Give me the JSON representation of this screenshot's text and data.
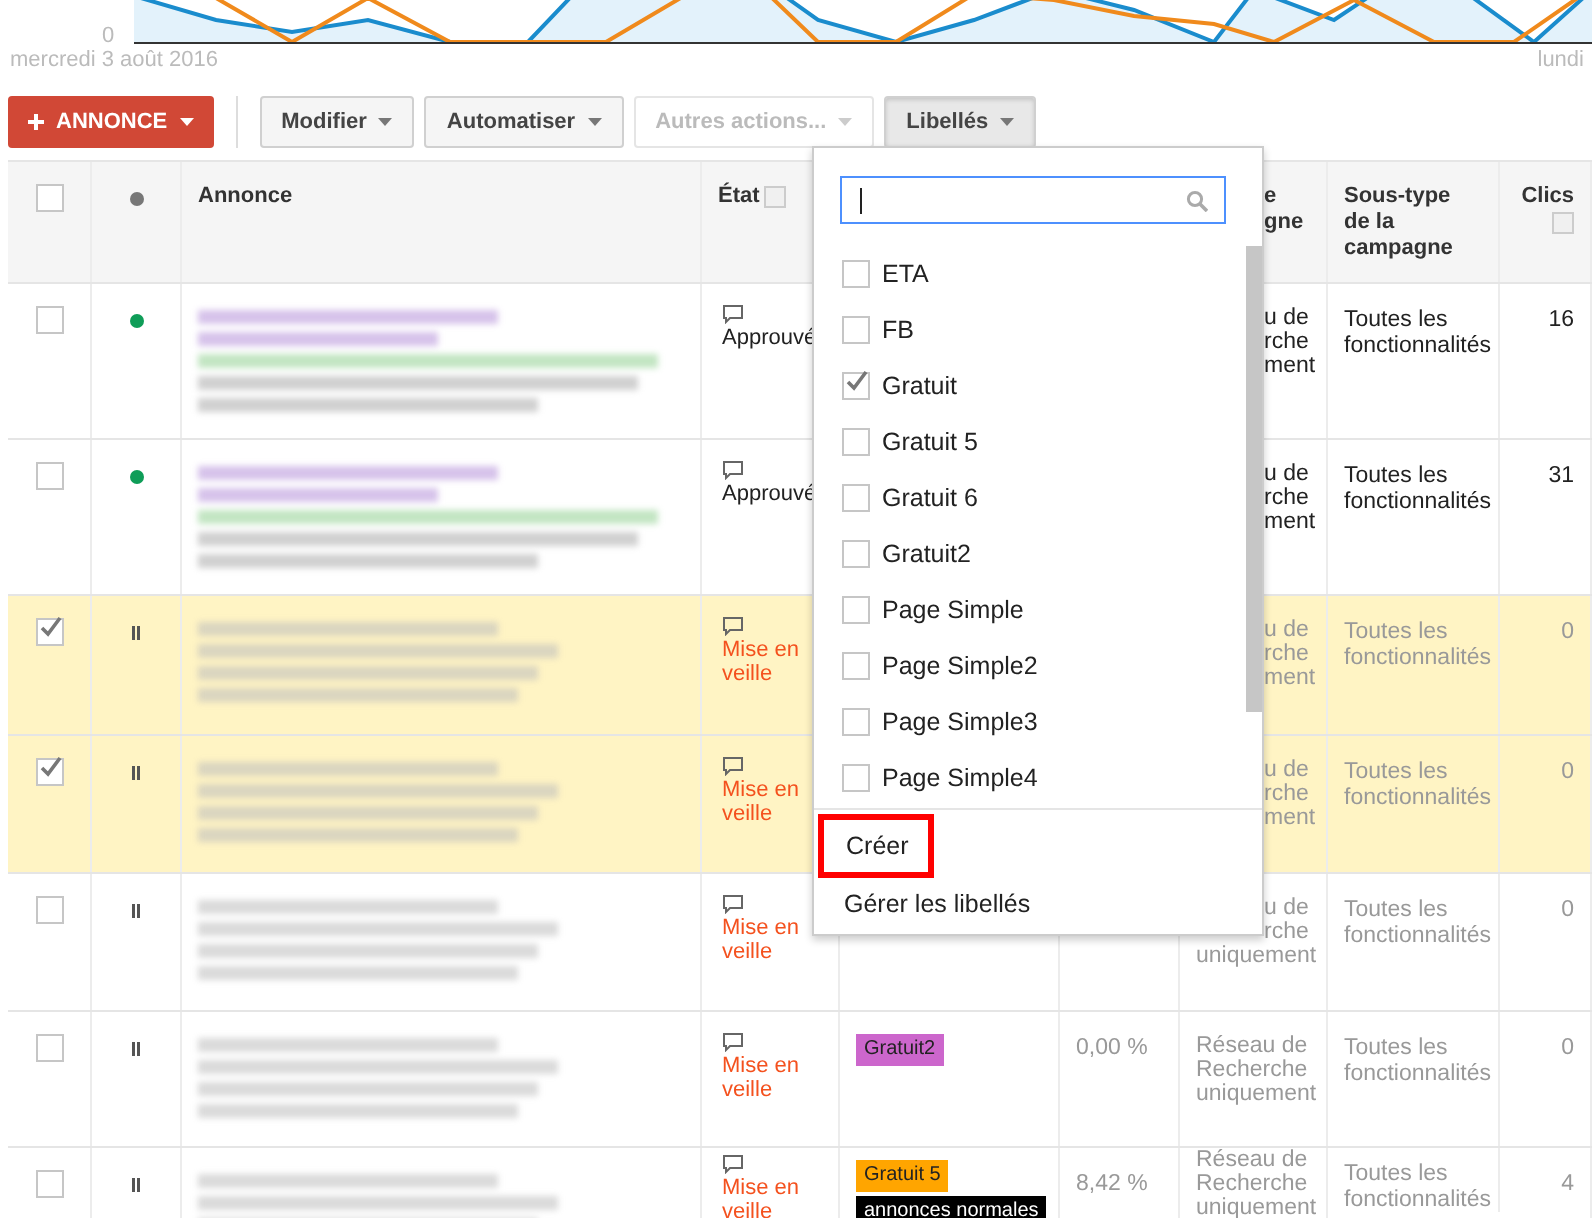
{
  "chart": {
    "y_tick": "0",
    "start_date": "mercredi 3 août 2016",
    "end_date": "lundi"
  },
  "toolbar": {
    "new_button": "ANNONCE",
    "buttons": [
      {
        "label": "Modifier",
        "disabled": false,
        "pressed": false
      },
      {
        "label": "Automatiser",
        "disabled": false,
        "pressed": false
      },
      {
        "label": "Autres actions...",
        "disabled": true,
        "pressed": false
      },
      {
        "label": "Libellés",
        "disabled": false,
        "pressed": true
      }
    ]
  },
  "table": {
    "header": {
      "checked": false,
      "ad": "Annonce",
      "state": "État",
      "type_lines": [
        {
          "text": "e",
          "cut": true
        },
        {
          "text": "gne",
          "cut": true
        }
      ],
      "subtype": "Sous-type de la campagne",
      "clicks": "Clics"
    },
    "rows": [
      {
        "checked": false,
        "kind": "enabled",
        "state": "Approuvé",
        "labels": [],
        "type_lines": [
          {
            "text": "u de",
            "cut": true
          },
          {
            "text": "rche",
            "cut": true
          },
          {
            "text": "ment",
            "cut": true
          }
        ],
        "subtype": "Toutes les fonctionnalités",
        "clicks": "16"
      },
      {
        "checked": false,
        "kind": "enabled",
        "state": "Approuvé",
        "labels": [],
        "type_lines": [
          {
            "text": "u de",
            "cut": true
          },
          {
            "text": "rche",
            "cut": true
          },
          {
            "text": "ment",
            "cut": true
          }
        ],
        "subtype": "Toutes les fonctionnalités",
        "clicks": "31"
      },
      {
        "checked": true,
        "kind": "paused",
        "state": "Mise en veille",
        "labels": [],
        "type_lines": [
          {
            "text": "u de",
            "cut": true
          },
          {
            "text": "rche",
            "cut": true
          },
          {
            "text": "ment",
            "cut": true
          }
        ],
        "subtype": "Toutes les fonctionnalités",
        "clicks": "0"
      },
      {
        "checked": true,
        "kind": "paused",
        "state": "Mise en veille",
        "labels": [],
        "type_lines": [
          {
            "text": "u de",
            "cut": true
          },
          {
            "text": "rche",
            "cut": true
          },
          {
            "text": "ment",
            "cut": true
          }
        ],
        "subtype": "Toutes les fonctionnalités",
        "clicks": "0"
      },
      {
        "checked": false,
        "kind": "paused",
        "state": "Mise en veille",
        "labels": [],
        "type_lines": [
          {
            "text": "u de",
            "cut": true
          },
          {
            "text": "rche",
            "cut": true
          },
          {
            "text": "uniquement",
            "cut": false
          }
        ],
        "subtype": "Toutes les fonctionnalités",
        "clicks": "0"
      },
      {
        "checked": false,
        "kind": "paused",
        "state": "Mise en veille",
        "labels": [
          {
            "text": "Gratuit2",
            "color": "#cc66cc"
          }
        ],
        "ctr": "0,00 %",
        "type_lines": [
          {
            "text": "Réseau de",
            "cut": false
          },
          {
            "text": "Recherche",
            "cut": false
          },
          {
            "text": "uniquement",
            "cut": false
          }
        ],
        "subtype": "Toutes les fonctionnalités",
        "clicks": "0"
      },
      {
        "checked": false,
        "kind": "paused",
        "state": "Mise en veille",
        "labels": [
          {
            "text": "Gratuit 5",
            "color": "#ffa500"
          },
          {
            "text": "annonces normales",
            "color": "#000000"
          }
        ],
        "ctr": "8,42 %",
        "type_lines": [
          {
            "text": "Réseau de",
            "cut": false
          },
          {
            "text": "Recherche",
            "cut": false
          },
          {
            "text": "uniquement",
            "cut": false
          }
        ],
        "subtype": "Toutes les fonctionnalités",
        "clicks": "4"
      }
    ]
  },
  "label_menu": {
    "options": [
      {
        "label": "ETA",
        "checked": false
      },
      {
        "label": "FB",
        "checked": false
      },
      {
        "label": "Gratuit",
        "checked": true
      },
      {
        "label": "Gratuit 5",
        "checked": false
      },
      {
        "label": "Gratuit 6",
        "checked": false
      },
      {
        "label": "Gratuit2",
        "checked": false
      },
      {
        "label": "Page Simple",
        "checked": false
      },
      {
        "label": "Page Simple2",
        "checked": false
      },
      {
        "label": "Page Simple3",
        "checked": false
      },
      {
        "label": "Page Simple4",
        "checked": false
      }
    ],
    "actions": [
      {
        "label": "Créer",
        "highlighted": true
      },
      {
        "label": "Gérer les libellés",
        "highlighted": false
      }
    ]
  }
}
